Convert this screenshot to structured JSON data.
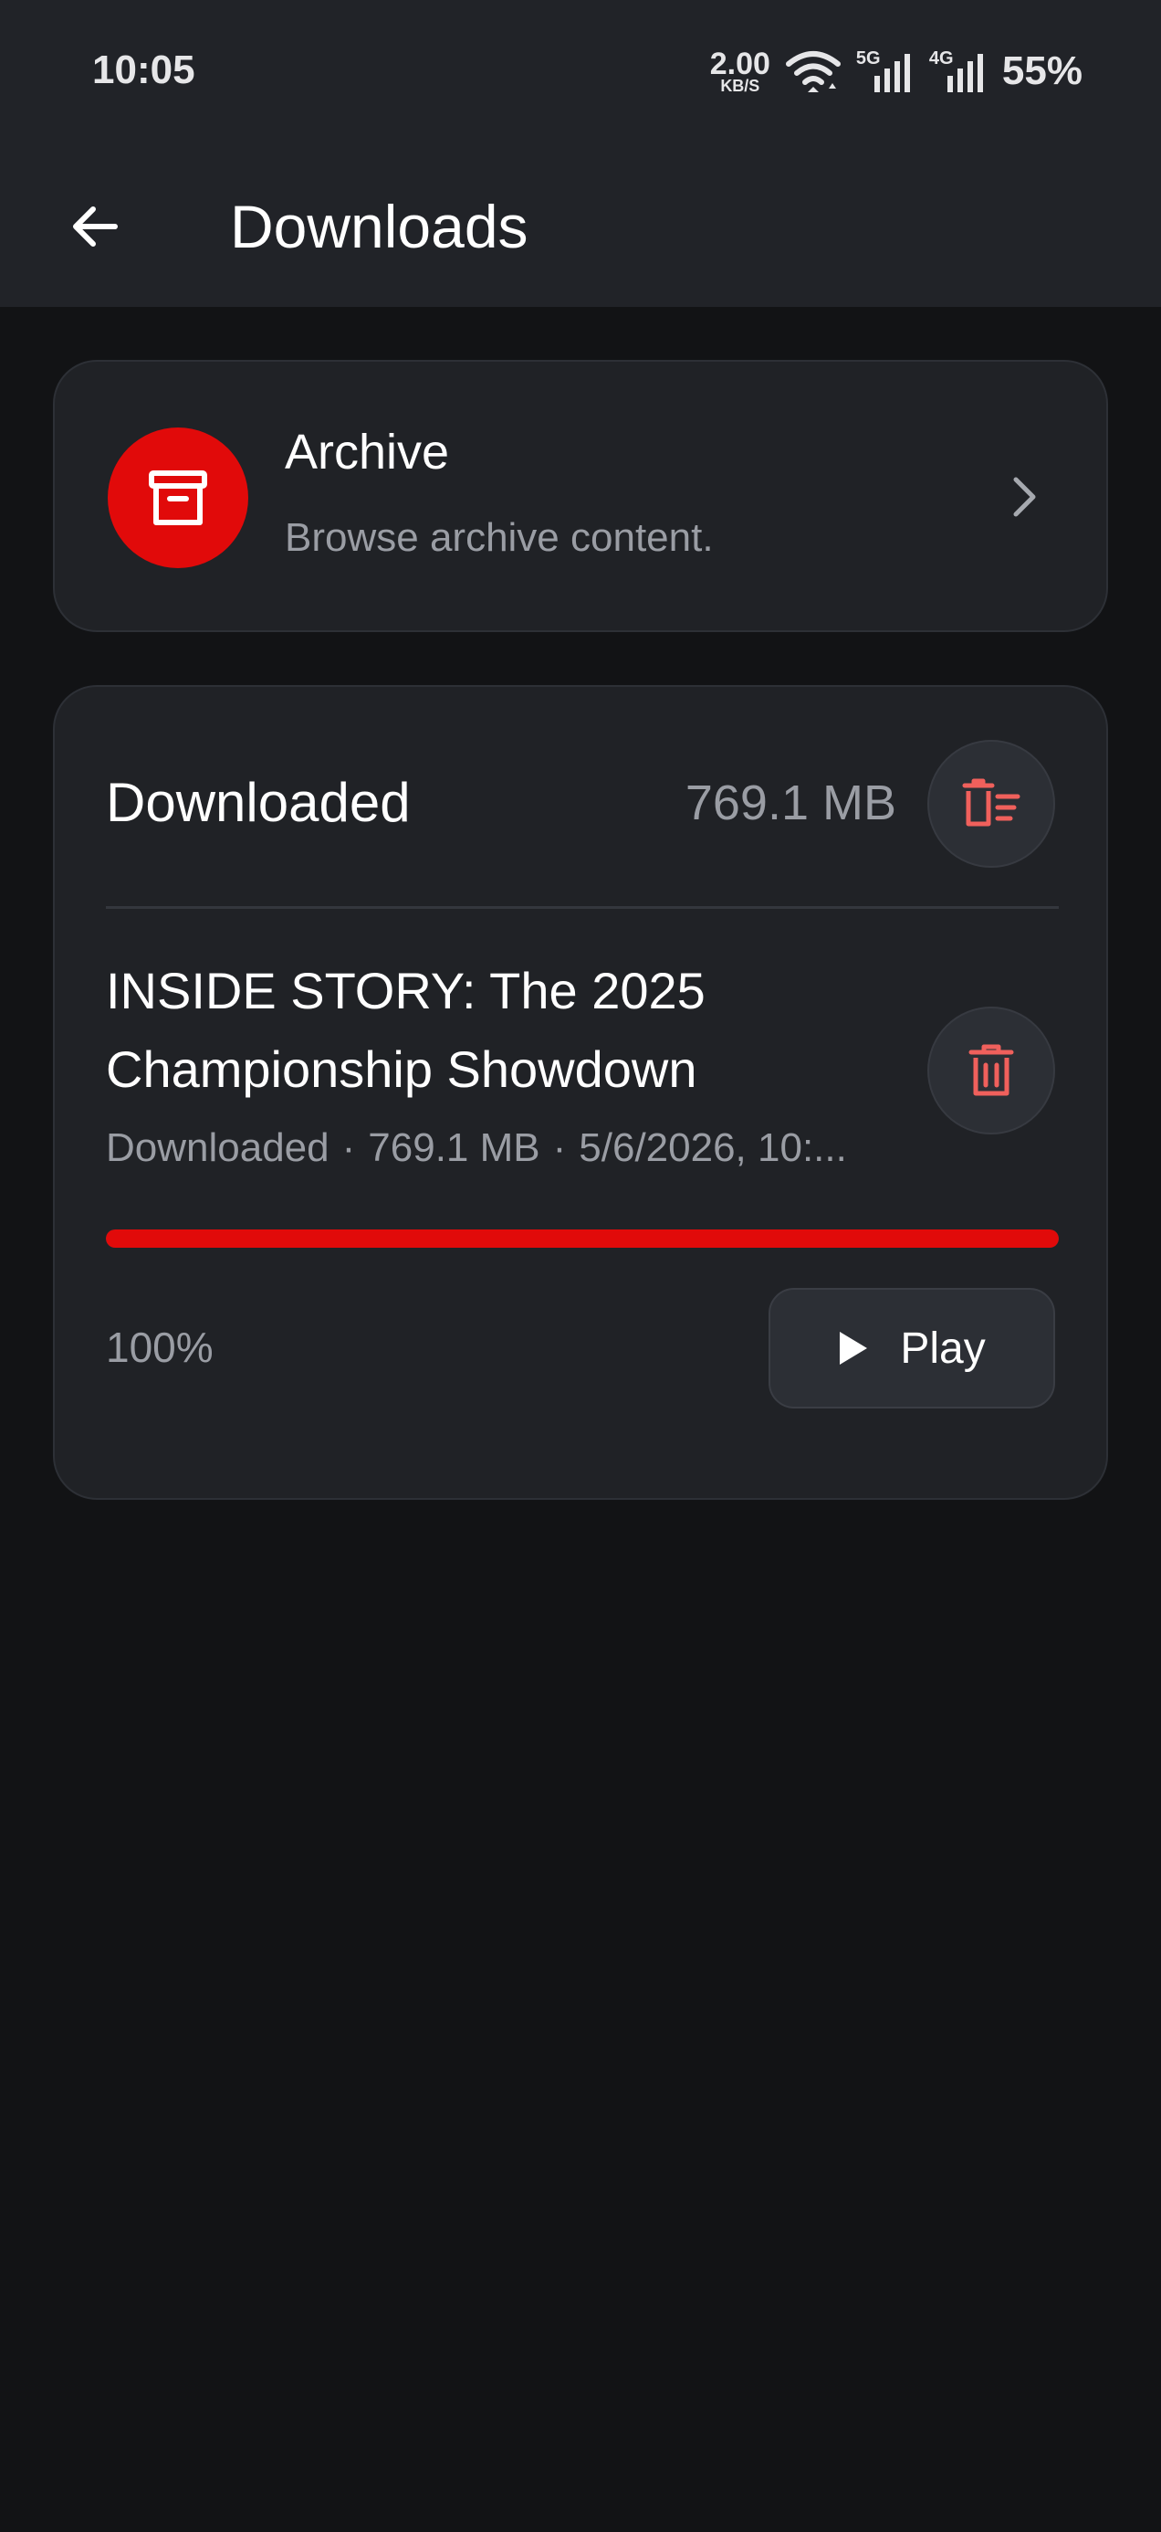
{
  "status_bar": {
    "time": "10:05",
    "net_speed_value": "2.00",
    "net_speed_unit": "KB/S",
    "signal_1_tag": "5G",
    "signal_2_tag": "4G",
    "battery": "55%",
    "icons": [
      "wifi-icon",
      "signal-5g-icon",
      "signal-4g-icon"
    ]
  },
  "header": {
    "title": "Downloads",
    "back_icon": "arrow-left-icon"
  },
  "archive": {
    "title": "Archive",
    "subtitle": "Browse archive content.",
    "icon": "archive-box-icon",
    "icon_bg": "#e10a0a"
  },
  "downloaded": {
    "heading": "Downloaded",
    "total_size": "769.1 MB",
    "clear_icon": "delete-sweep-icon",
    "items": [
      {
        "title": "INSIDE STORY: The 2025 Championship Showdown",
        "status": "Downloaded",
        "separator": "·",
        "size": "769.1 MB",
        "date": "5/6/2026, 10:...",
        "progress_percent": 100,
        "progress_label": "100%",
        "play_label": "Play",
        "delete_icon": "trash-icon",
        "play_icon": "play-icon"
      }
    ]
  },
  "colors": {
    "accent_red": "#e10a0a",
    "danger_icon": "#f0605c",
    "background": "#121315",
    "card": "#202226"
  }
}
